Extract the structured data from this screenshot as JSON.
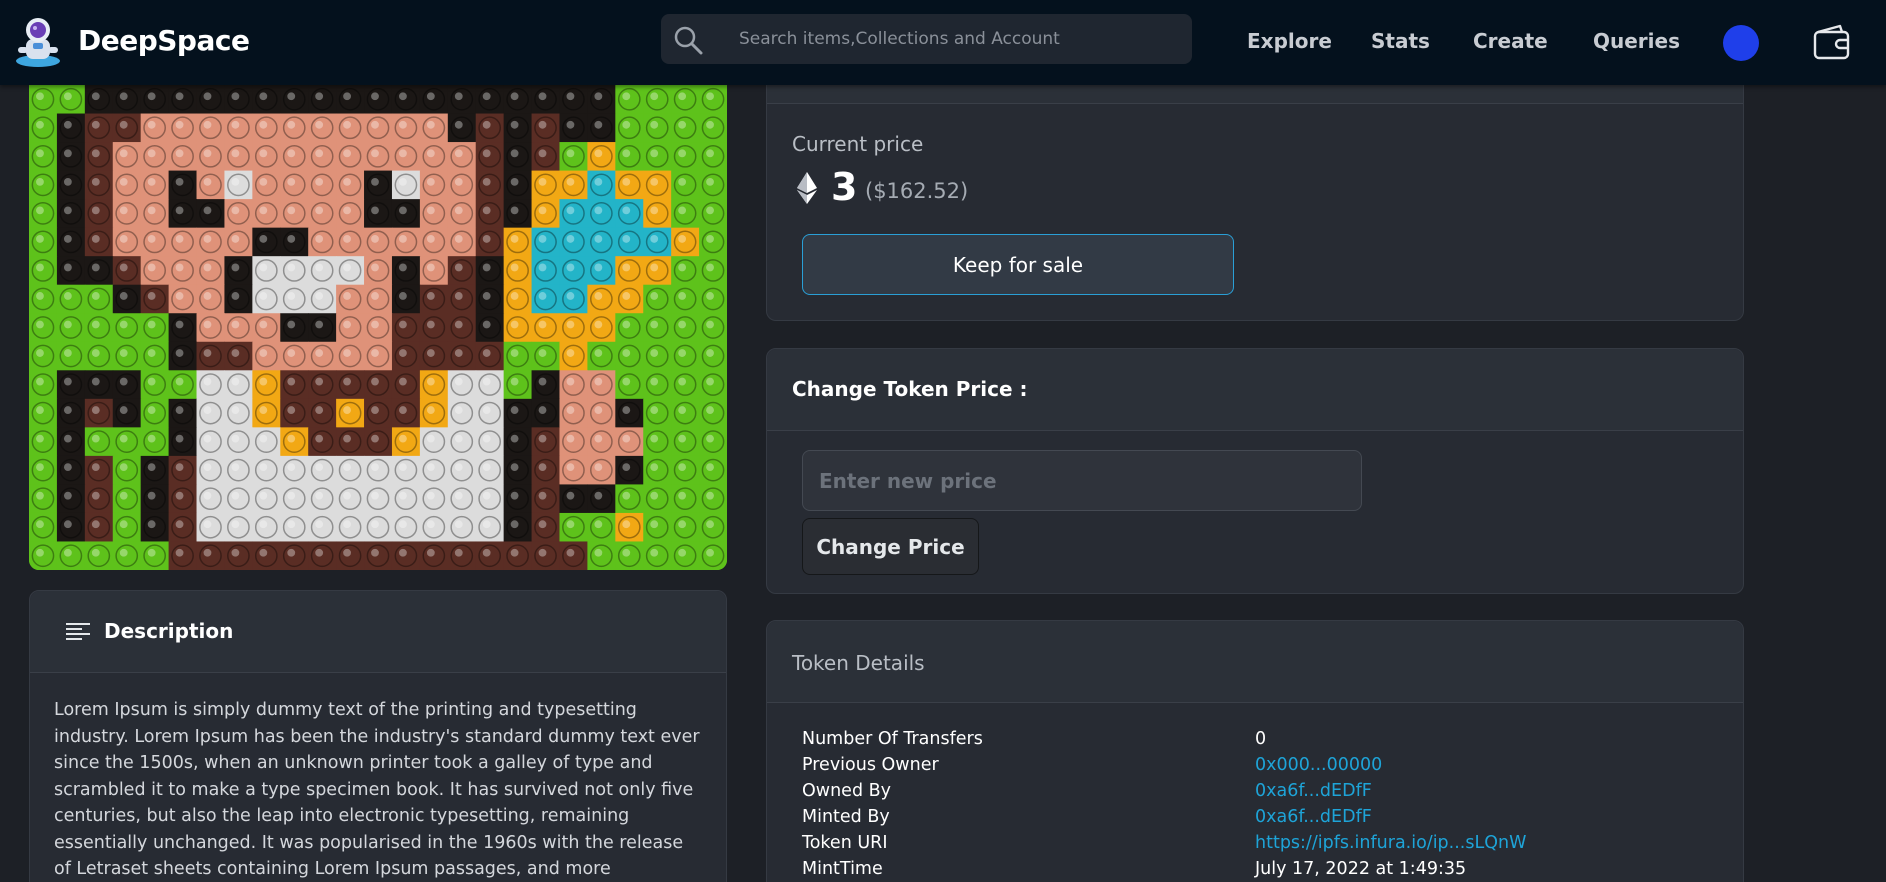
{
  "navbar": {
    "brand": "DeepSpace",
    "search_placeholder": "Search items,Collections and Account",
    "links": [
      "Explore",
      "Stats",
      "Create",
      "Queries"
    ],
    "avatar_color": "#1f3fea",
    "icons": [
      "astronaut-logo-icon",
      "search-icon",
      "wallet-icon"
    ]
  },
  "nft_image": {
    "alt": "pixel art NFT"
  },
  "description": {
    "title": "Description",
    "icon": "lines-icon",
    "text": "Lorem Ipsum is simply dummy text of the printing and typesetting industry. Lorem Ipsum has been the industry's standard dummy text ever since the 1500s, when an unknown printer took a galley of type and scrambled it to make a type specimen book. It has survived not only five centuries, but also the leap into electronic typesetting, remaining essentially unchanged. It was popularised in the 1960s with the release of Letraset sheets containing Lorem Ipsum passages, and more"
  },
  "price": {
    "label": "Current price",
    "amount": "3",
    "usd": "($162.52)",
    "icon": "ethereum-icon",
    "sale_button": "Keep for sale",
    "accent_color": "#2a9fd6"
  },
  "change_price": {
    "title": "Change Token Price :",
    "input_placeholder": "Enter new price",
    "button": "Change Price"
  },
  "token_details": {
    "title": "Token Details",
    "rows": [
      {
        "key": "Number Of Transfers",
        "value": "0",
        "link": false
      },
      {
        "key": "Previous Owner",
        "value": "0x000...00000",
        "link": true
      },
      {
        "key": "Owned By",
        "value": "0xa6f...dEDfF",
        "link": true
      },
      {
        "key": "Minted By",
        "value": "0xa6f...dEDfF",
        "link": true
      },
      {
        "key": "Token URI",
        "value": "https://ipfs.infura.io/ip...sLQnW",
        "link": true
      },
      {
        "key": "MintTime",
        "value": "July 17, 2022 at 1:49:35",
        "link": false
      }
    ],
    "link_color": "#1ea4d8"
  }
}
